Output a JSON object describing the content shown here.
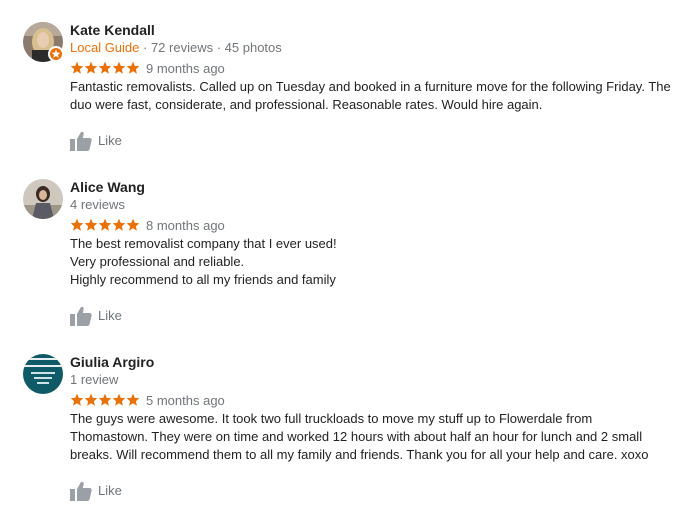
{
  "reviews": [
    {
      "name": "Kate Kendall",
      "badge": "Local Guide",
      "reviews_count": "72 reviews",
      "photos": "45 photos",
      "separator": " · ",
      "rating": 5,
      "date": "9 months ago",
      "text_lines": [
        "Fantastic removalists. Called up on Tuesday and booked in a furniture move for the following Friday. The",
        "duo were fast, considerate, and professional. Reasonable rates. Would hire again."
      ],
      "like_label": "Like"
    },
    {
      "name": "Alice Wang",
      "reviews_count": "4 reviews",
      "rating": 5,
      "date": "8 months ago",
      "text_lines": [
        "The best removalist company that I ever used!",
        "Very professional and reliable.",
        "Highly recommend to all my friends and family"
      ],
      "like_label": "Like"
    },
    {
      "name": "Giulia Argiro",
      "reviews_count": "1 review",
      "rating": 5,
      "date": "5 months ago",
      "text_lines": [
        "The guys were awesome. It took two full truckloads to move my stuff up to Flowerdale from",
        "Thomastown. They were on time and worked 12 hours with about half an hour for lunch and 2 small",
        "breaks. Will recommend them to all my family and friends. Thank you for all your help and care. xoxo"
      ],
      "like_label": "Like"
    }
  ],
  "colors": {
    "star": "#e8710a",
    "badge": "#e8710a",
    "meta": "#70757a",
    "like": "#9aa0a6"
  },
  "icons": {
    "star": "star-icon",
    "like": "thumbs-up-icon",
    "badge": "local-guide-star-badge-icon"
  }
}
